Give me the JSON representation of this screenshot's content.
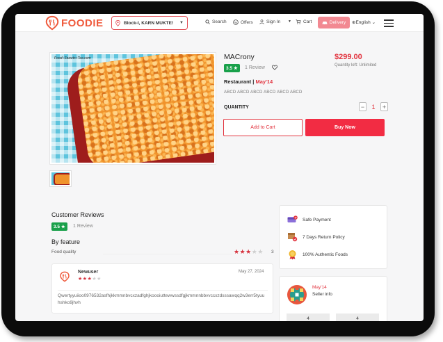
{
  "header": {
    "brand": "FOODIE",
    "location": "Block-I, KARN MUKTE!",
    "nav": {
      "search": "Search",
      "offers": "Offers",
      "sign_in": "Sign In",
      "cart": "Cart",
      "delivery": "Delivery",
      "language": "English"
    }
  },
  "product": {
    "image_watermark": "Food+Sweets+Tea.com",
    "title": "MACrony",
    "price": "$299.00",
    "quantity_left": "Quantity left: Unlimited",
    "rating": "3.5",
    "review_count": "1 Review",
    "restaurant_prefix": "Restaurant |",
    "restaurant_name": "May'14",
    "description": "ABCD ABCD ABCD ABCD ABCD ABCD",
    "quantity_label": "QUANTITY",
    "quantity_minus": "−",
    "quantity_value": "1",
    "quantity_plus": "+",
    "add_to_cart": "Add to Cart",
    "buy_now": "Buy Now"
  },
  "reviews": {
    "title": "Customer Reviews",
    "rating": "3.5",
    "review_count": "1 Review",
    "by_feature_title": "By feature",
    "features": [
      {
        "label": "Food quality",
        "stars": 3,
        "max": 5,
        "count": "3"
      }
    ],
    "items": [
      {
        "name": "Newuser",
        "date": "May 27, 2024",
        "stars": 3,
        "max": 5,
        "text": "Qwertyyuiioo0976532asfhjkkmmnbvcxzadfghjkoooiuttewwssdfgjkmmnnbbvvccxzdsssawqq2w3err5tyuuhshko9jhvh"
      }
    ]
  },
  "features_panel": {
    "items": [
      {
        "icon": "safe-payment-icon",
        "label": "Safe Payment"
      },
      {
        "icon": "return-policy-icon",
        "label": "7 Days Return Policy"
      },
      {
        "icon": "authentic-badge-icon",
        "label": "100% Authentic Foods"
      }
    ]
  },
  "seller": {
    "name": "May'14",
    "info_label": "Seller info",
    "stats": [
      "4",
      "4"
    ]
  },
  "colors": {
    "brand": "#ef5a3c",
    "accent": "#e2343f",
    "buy_button": "#f22c43",
    "delivery_button": "#f28992",
    "rating_badge": "#19a04a"
  }
}
